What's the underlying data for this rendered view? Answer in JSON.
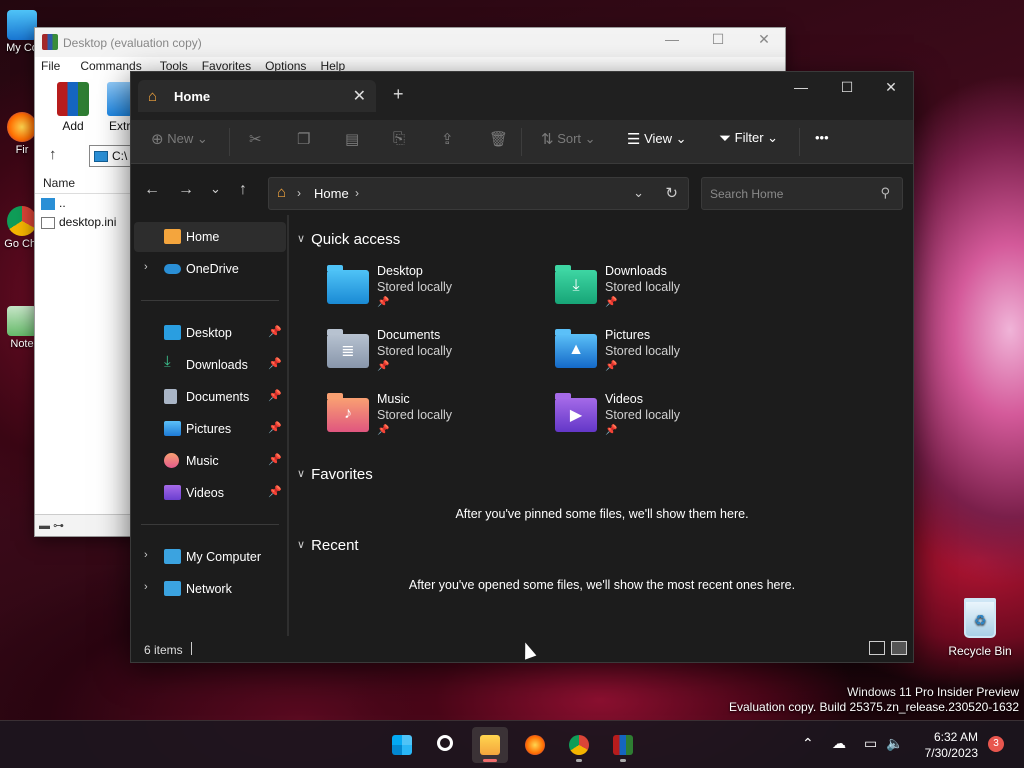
{
  "desktop": {
    "icons": [
      {
        "label": "My Co"
      },
      {
        "label": "Fir"
      },
      {
        "label": "Go Chr"
      },
      {
        "label": "Note"
      }
    ],
    "recycle_bin": "Recycle Bin",
    "watermark": {
      "line1": "Windows 11 Pro Insider Preview",
      "line2": "Evaluation copy. Build 25375.zn_release.230520-1632"
    }
  },
  "winrar": {
    "title": "Desktop (evaluation copy)",
    "menu": [
      "File",
      "Commands",
      "Tools",
      "Favorites",
      "Options",
      "Help"
    ],
    "tools": [
      "Add",
      "Extra"
    ],
    "path": "C:\\",
    "column_name": "Name",
    "files": [
      "..",
      "desktop.ini"
    ]
  },
  "explorer": {
    "tab_label": "Home",
    "toolbar": {
      "new": "New",
      "sort": "Sort",
      "view": "View",
      "filter": "Filter",
      "more": "•••"
    },
    "address": {
      "location": "Home"
    },
    "search_placeholder": "Search Home",
    "sidebar": {
      "home": "Home",
      "onedrive": "OneDrive",
      "pinned": [
        "Desktop",
        "Downloads",
        "Documents",
        "Pictures",
        "Music",
        "Videos"
      ],
      "my_computer": "My Computer",
      "network": "Network"
    },
    "sections": {
      "quick_access": "Quick access",
      "favorites": "Favorites",
      "recent": "Recent"
    },
    "quick_access": [
      {
        "name": "Desktop",
        "sub": "Stored locally"
      },
      {
        "name": "Downloads",
        "sub": "Stored locally"
      },
      {
        "name": "Documents",
        "sub": "Stored locally"
      },
      {
        "name": "Pictures",
        "sub": "Stored locally"
      },
      {
        "name": "Music",
        "sub": "Stored locally"
      },
      {
        "name": "Videos",
        "sub": "Stored locally"
      }
    ],
    "favorites_empty": "After you've pinned some files, we'll show them here.",
    "recent_empty": "After you've opened some files, we'll show the most recent ones here.",
    "status": {
      "item_count": "6 items"
    }
  },
  "taskbar": {
    "time": "6:32 AM",
    "date": "7/30/2023",
    "notifications": "3"
  },
  "colors": {
    "folder_accent": "#f4a53d",
    "explorer_bg": "#1c1c1c",
    "toolbar_bg": "#2b2b2b"
  }
}
